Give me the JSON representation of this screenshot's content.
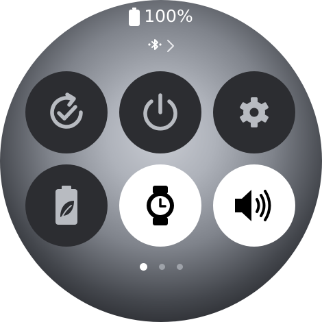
{
  "status": {
    "battery_percent": "100%",
    "battery_level": 1.0,
    "battery_icon": "battery-full-icon"
  },
  "bluetooth": {
    "icon": "bluetooth-icon",
    "chevron": "chevron-right-icon"
  },
  "tiles": [
    {
      "id": "sync",
      "icon": "sync-check-icon",
      "state": "off"
    },
    {
      "id": "power",
      "icon": "power-icon",
      "state": "off"
    },
    {
      "id": "settings",
      "icon": "gear-icon",
      "state": "off"
    },
    {
      "id": "power-saving",
      "icon": "battery-leaf-icon",
      "state": "off"
    },
    {
      "id": "watch-only",
      "icon": "watch-clock-icon",
      "state": "on"
    },
    {
      "id": "sound",
      "icon": "speaker-volume-icon",
      "state": "on"
    }
  ],
  "pagination": {
    "total": 3,
    "current": 1
  },
  "colors": {
    "tile_off": "#2c2d31",
    "tile_on": "#ffffff",
    "icon_off": "#b8bbc1",
    "icon_on": "#000000",
    "text": "#ffffff"
  }
}
